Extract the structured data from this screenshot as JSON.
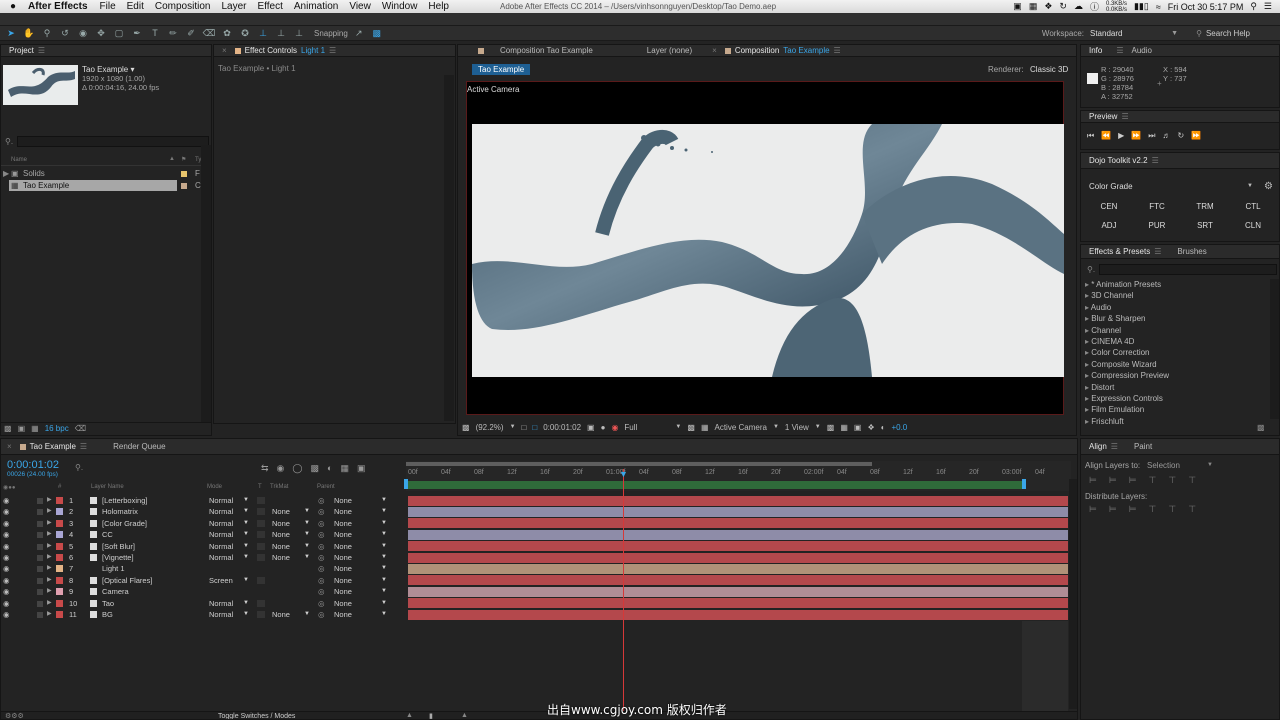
{
  "menubar": {
    "app": "After Effects",
    "items": [
      "File",
      "Edit",
      "Composition",
      "Layer",
      "Effect",
      "Animation",
      "View",
      "Window",
      "Help"
    ],
    "window_title": "Adobe After Effects CC 2014 – /Users/vinhsonnguyen/Desktop/Tao Demo.aep",
    "net_up": "0.3KB/s",
    "net_down": "0.0KB/s",
    "clock": "Fri Oct 30  5:17 PM"
  },
  "toolbar": {
    "snapping": "Snapping",
    "workspace_label": "Workspace:",
    "workspace_value": "Standard",
    "search_help": "Search Help"
  },
  "project": {
    "tab": "Project",
    "comp_name": "Tao Example ▾",
    "comp_res": "1920 x 1080 (1.00)",
    "comp_dur": "Δ 0:00:04:16, 24.00 fps",
    "col_name": "Name",
    "col_type": "Type",
    "items": [
      {
        "name": "Solids",
        "type": "F"
      },
      {
        "name": "Tao Example",
        "type": "C"
      }
    ],
    "bpc": "16 bpc"
  },
  "effect_controls": {
    "tab_prefix": "Effect Controls",
    "tab_layer": "Light 1",
    "subtitle": "Tao Example • Light 1"
  },
  "viewer": {
    "tab_comp_left": "Composition Tao Example",
    "tab_layer": "Layer (none)",
    "tab_comp_prefix": "Composition",
    "tab_comp_name": "Tao Example",
    "flow_tab": "Tao Example",
    "renderer_label": "Renderer:",
    "renderer_value": "Classic 3D",
    "active_camera_label": "Active Camera",
    "zoom": "(92.2%)",
    "timecode": "0:00:01:02",
    "resolution": "Full",
    "camera_view": "Active Camera",
    "views": "1 View",
    "exposure": "+0.0"
  },
  "info": {
    "tab": "Info",
    "tab2": "Audio",
    "r": "R : 29040",
    "g": "G : 28976",
    "b": "B : 28784",
    "a": "A : 32752",
    "x": "X : 594",
    "y": "Y : 737"
  },
  "preview": {
    "tab": "Preview"
  },
  "dojo": {
    "tab": "Dojo Toolkit v2.2",
    "dropdown": "Color Grade",
    "buttons": [
      "CEN",
      "FTC",
      "TRM",
      "CTL",
      "ADJ",
      "PUR",
      "SRT",
      "CLN"
    ]
  },
  "effects": {
    "tab": "Effects & Presets",
    "tab2": "Brushes",
    "items": [
      "* Animation Presets",
      "3D Channel",
      "Audio",
      "Blur & Sharpen",
      "Channel",
      "CINEMA 4D",
      "Color Correction",
      "Composite Wizard",
      "Compression Preview",
      "Distort",
      "Expression Controls",
      "Film Emulation",
      "Frischluft"
    ]
  },
  "align": {
    "tab": "Align",
    "tab2": "Paint",
    "align_to_label": "Align Layers to:",
    "align_to_value": "Selection",
    "distribute": "Distribute Layers:"
  },
  "timeline": {
    "tab": "Tao Example",
    "tab2": "Render Queue",
    "timecode": "0:00:01:02",
    "frames": "00026 (24.00 fps)",
    "cols": {
      "num": "#",
      "name": "Layer Name",
      "mode": "Mode",
      "t": "T",
      "trkmat": "TrkMat",
      "parent": "Parent"
    },
    "ruler": [
      "00f",
      "04f",
      "08f",
      "12f",
      "16f",
      "20f",
      "01:00f",
      "04f",
      "08f",
      "12f",
      "16f",
      "20f",
      "02:00f",
      "04f",
      "08f",
      "12f",
      "16f",
      "20f",
      "03:00f",
      "04f"
    ],
    "bottom": "Toggle Switches / Modes",
    "layers": [
      {
        "num": "1",
        "name": "[Letterboxing]",
        "mode": "Normal",
        "trk": "",
        "parent": "None",
        "label": "#c84a4a",
        "bar": "#b4484c"
      },
      {
        "num": "2",
        "name": "Holomatrix",
        "mode": "Normal",
        "trk": "None",
        "parent": "None",
        "label": "#a9a6d4",
        "bar": "#8e8ca8"
      },
      {
        "num": "3",
        "name": "[Color Grade]",
        "mode": "Normal",
        "trk": "None",
        "parent": "None",
        "label": "#c84a4a",
        "bar": "#b4484c"
      },
      {
        "num": "4",
        "name": "CC",
        "mode": "Normal",
        "trk": "None",
        "parent": "None",
        "label": "#a9a6d4",
        "bar": "#8e8ca8"
      },
      {
        "num": "5",
        "name": "[Soft Blur]",
        "mode": "Normal",
        "trk": "None",
        "parent": "None",
        "label": "#c84a4a",
        "bar": "#b4484c"
      },
      {
        "num": "6",
        "name": "[Vignette]",
        "mode": "Normal",
        "trk": "None",
        "parent": "None",
        "label": "#c84a4a",
        "bar": "#b4484c"
      },
      {
        "num": "7",
        "name": "Light 1",
        "mode": "",
        "trk": "",
        "parent": "None",
        "label": "#e4b487",
        "bar": "#b09278"
      },
      {
        "num": "8",
        "name": "[Optical Flares]",
        "mode": "Screen",
        "trk": "",
        "parent": "None",
        "label": "#c84a4a",
        "bar": "#b4484c"
      },
      {
        "num": "9",
        "name": "Camera",
        "mode": "",
        "trk": "",
        "parent": "None",
        "label": "#e0a0b0",
        "bar": "#b08d96"
      },
      {
        "num": "10",
        "name": "Tao",
        "mode": "Normal",
        "trk": "",
        "parent": "None",
        "label": "#c84a4a",
        "bar": "#b4484c"
      },
      {
        "num": "11",
        "name": "BG",
        "mode": "Normal",
        "trk": "None",
        "parent": "None",
        "label": "#c84a4a",
        "bar": "#b4484c"
      }
    ]
  },
  "watermark": "出自www.cgjoy.com 版权归作者"
}
